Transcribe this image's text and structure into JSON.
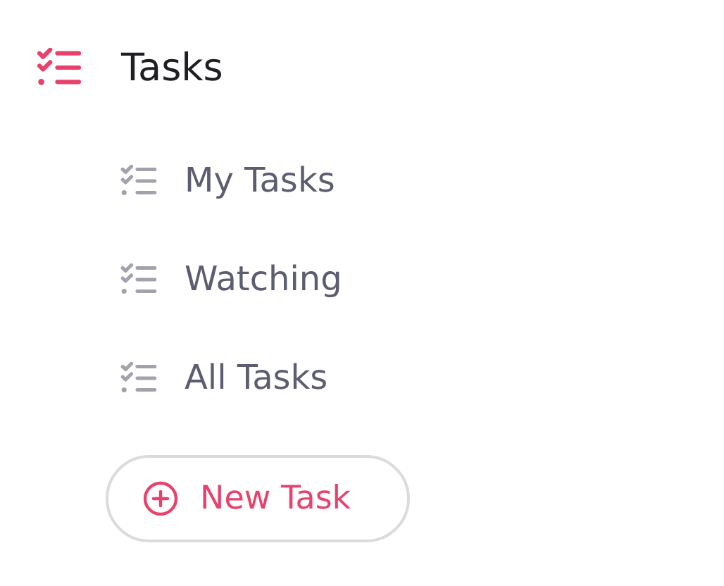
{
  "header": {
    "title": "Tasks"
  },
  "items": [
    {
      "label": "My Tasks"
    },
    {
      "label": "Watching"
    },
    {
      "label": "All Tasks"
    }
  ],
  "button": {
    "label": "New Task"
  }
}
